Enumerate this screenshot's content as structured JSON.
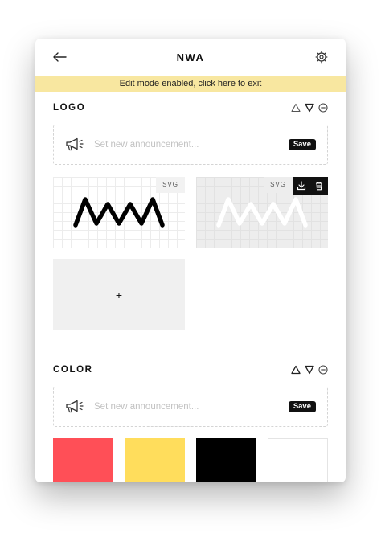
{
  "header": {
    "title": "NWA",
    "back_icon": "arrow-left-icon",
    "settings_icon": "gear-icon"
  },
  "banner": {
    "text": "Edit mode enabled, click here to exit"
  },
  "logo_section": {
    "title": "LOGO",
    "announcement": {
      "placeholder": "Set new announcement...",
      "save_label": "Save"
    },
    "assets": [
      {
        "format_label": "SVG",
        "background": "white"
      },
      {
        "format_label": "SVG",
        "background": "gray",
        "actions": [
          "download-icon",
          "trash-icon"
        ]
      }
    ],
    "add_label": "+"
  },
  "color_section": {
    "title": "COLOR",
    "announcement": {
      "placeholder": "Set new announcement...",
      "save_label": "Save"
    },
    "swatches": [
      "#ff4f57",
      "#ffdd5c",
      "#000000",
      "#ffffff"
    ]
  },
  "colors": {
    "banner": "#f8e7a0",
    "accent": "#111111"
  }
}
